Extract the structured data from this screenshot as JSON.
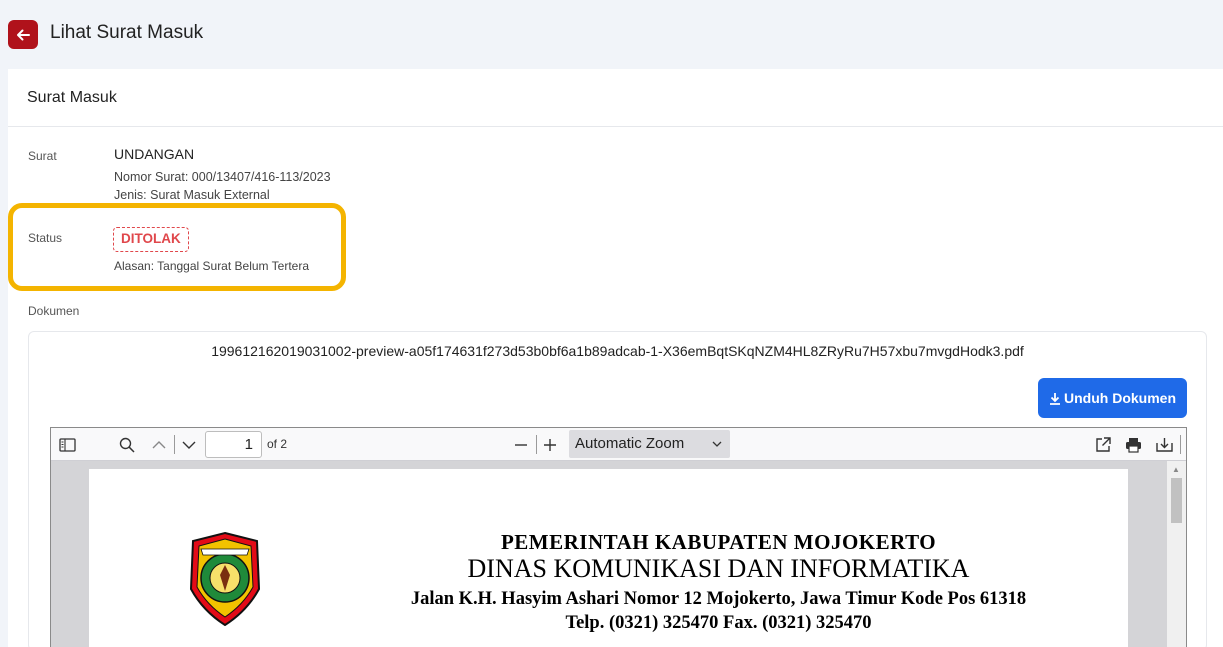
{
  "header": {
    "title": "Lihat Surat Masuk"
  },
  "card": {
    "title": "Surat Masuk",
    "surat": {
      "label": "Surat",
      "type": "UNDANGAN",
      "nomor": "Nomor Surat: 000/13407/416-113/2023",
      "jenis": "Jenis: Surat Masuk External"
    },
    "status": {
      "label": "Status",
      "value": "DITOLAK",
      "reason": "Alasan: Tanggal Surat Belum Tertera"
    },
    "dokumen": {
      "label": "Dokumen",
      "filename": "199612162019031002-preview-a05f174631f273d53b0bf6a1b89adcab-1-X36emBqtSKqNZM4HL8ZRyRu7H57xbu7mvgdHodk3.pdf",
      "download_label": "Unduh Dokumen"
    }
  },
  "viewer": {
    "page_number": "1",
    "page_of": "of 2",
    "zoom": "Automatic Zoom",
    "letterhead": {
      "line1": "PEMERINTAH  KABUPATEN  MOJOKERTO",
      "line2": "DINAS KOMUNIKASI DAN INFORMATIKA",
      "line3": "Jalan K.H. Hasyim Ashari Nomor 12 Mojokerto, Jawa Timur Kode Pos 61318",
      "line4": "Telp. (0321) 325470 Fax. (0321) 325470"
    }
  },
  "colors": {
    "back_button": "#b0121b",
    "status_rejected": "#e0474b",
    "highlight": "#f4b400",
    "primary": "#1f6ae8"
  },
  "icons": [
    "arrow-left-icon",
    "sidebar-toggle-icon",
    "search-icon",
    "chevron-up-icon",
    "chevron-down-icon",
    "minus-icon",
    "plus-icon",
    "open-external-icon",
    "print-icon",
    "save-icon",
    "download-icon"
  ]
}
